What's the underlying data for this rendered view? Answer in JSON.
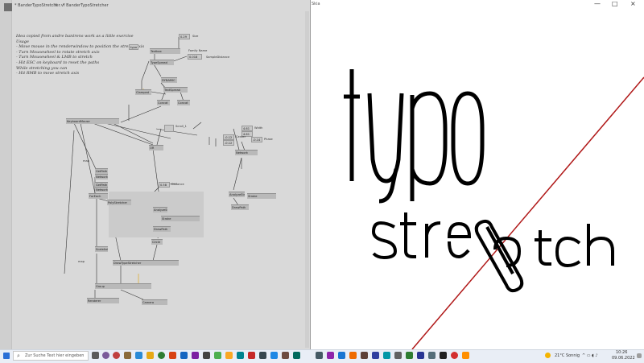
{
  "tabs": [
    {
      "label": "* BanderTypoStretcher.vl"
    },
    {
      "label": "* BanderTypoStretcher"
    }
  ],
  "tab_close": "×",
  "notes": [
    "Idea copied from andre bantrens work as a little exercise",
    "",
    "Usage",
    "- Move mouse in the renderwindow to position the stretch axis",
    "- Turn Mousewheel to rotate stretch axis",
    "- Turn Mousewheel & LMB to stretch",
    "- Hit ESC on keyboard to reset the paths",
    "While stretching you can",
    "- Hit RMB to move stretch axis"
  ],
  "patch": {
    "size_label": "Size",
    "size_value": "0.29",
    "size_in": "Size",
    "family_name": "Family Name",
    "sample_distance": "SampleDistance",
    "sample_value": "0.018",
    "text_in": "typo",
    "nodes": [
      "Textbox",
      "TypeSpread",
      "DYNAMIC",
      "Clamped",
      "TextSpread",
      "Concat",
      "Concat",
      "KeyboardMouse",
      "OR",
      "GetPath",
      "GetPath",
      "Network",
      "Network",
      "ForEach",
      "PolyStretcher",
      "AnalyzeStretch",
      "Stroke",
      "DrawPath",
      "Circle",
      "ScaleAxis",
      "Network",
      "DrawTypeStretcher",
      "Group",
      "Renderer",
      "Camera",
      "AnalyzeStroke",
      "DrawPath",
      "AbsoluteToRel",
      "Stroke"
    ],
    "scroll_label": "Scroll_1",
    "width_label": "Width",
    "width_values": [
      "4.61",
      "4.61"
    ],
    "phase_label": "Phase",
    "phase_values": [
      "-0.12",
      "-0.12"
    ],
    "phase_out": "-0.14",
    "center_label": "Center",
    "distance_label": "Distance",
    "distance_value": "0.58",
    "out_label": "map",
    "out_label2": "map"
  },
  "render_window": {
    "title": "Skia",
    "minimize": "—",
    "maximize": "□",
    "close": "×",
    "accent_color": "#b01818",
    "stroke_color": "#000000",
    "line1": "typo",
    "line2_start": "str",
    "line2_end": "tch"
  },
  "taskbar": {
    "search_placeholder": "Zur Suche Text hier eingeben",
    "weather": "21°C Sonnig",
    "time": "10:26",
    "date": "09.06.2022"
  }
}
